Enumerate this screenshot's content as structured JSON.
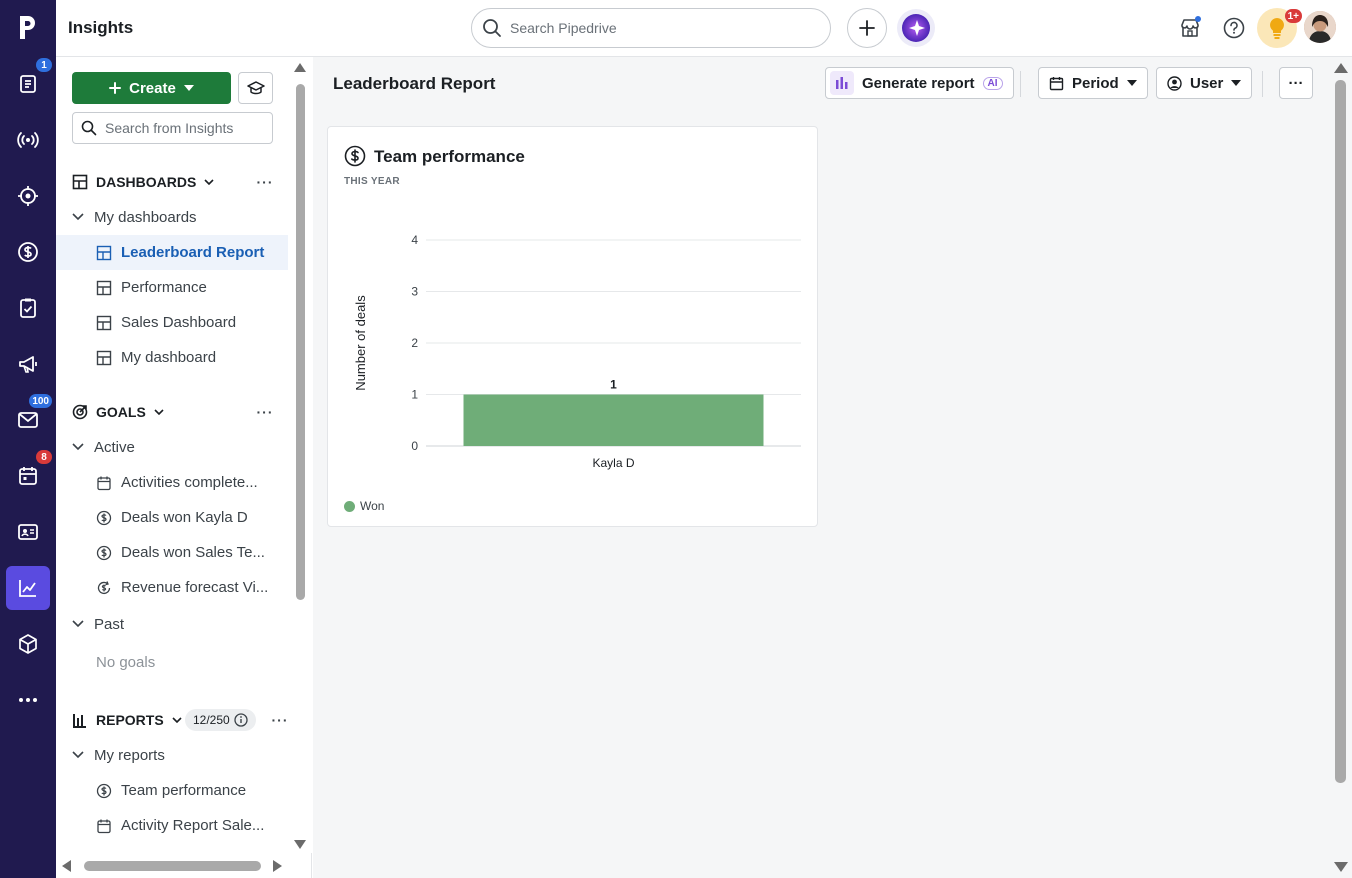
{
  "rail": {
    "logo": "p",
    "items": [
      {
        "icon": "leads-icon",
        "badge": "1",
        "badge_color": "#2f6fde"
      },
      {
        "icon": "broadcast-icon",
        "badge": ""
      },
      {
        "icon": "target-icon",
        "badge": ""
      },
      {
        "icon": "deals-dollar-icon",
        "badge": ""
      },
      {
        "icon": "tasks-clipboard-icon",
        "badge": ""
      },
      {
        "icon": "megaphone-icon",
        "badge": ""
      },
      {
        "icon": "mail-icon",
        "badge": "100",
        "badge_color": "#2f6fde"
      },
      {
        "icon": "calendar-icon",
        "badge": "8",
        "badge_color": "#d93a3a"
      },
      {
        "icon": "contacts-card-icon",
        "badge": ""
      },
      {
        "icon": "insights-chart-icon",
        "badge": "",
        "active": true
      },
      {
        "icon": "products-box-icon",
        "badge": ""
      },
      {
        "icon": "more-icon",
        "badge": ""
      }
    ]
  },
  "topbar": {
    "title": "Insights",
    "search_placeholder": "Search Pipedrive",
    "notification_badge": "1+"
  },
  "sidebar": {
    "create_label": "Create",
    "search_placeholder": "Search from Insights",
    "dashboards": {
      "header": "DASHBOARDS",
      "group": "My dashboards",
      "items": [
        "Leaderboard Report",
        "Performance",
        "Sales Dashboard",
        "My dashboard"
      ],
      "selected": "Leaderboard Report"
    },
    "goals": {
      "header": "GOALS",
      "active_label": "Active",
      "items": [
        "Activities complete...",
        "Deals won Kayla D",
        "Deals won Sales Te...",
        "Revenue forecast Vi..."
      ],
      "past_label": "Past",
      "empty_label": "No goals"
    },
    "reports": {
      "header": "REPORTS",
      "count": "12/250",
      "group": "My reports",
      "items": [
        "Team performance",
        "Activity Report Sale..."
      ]
    }
  },
  "main": {
    "title": "Leaderboard Report",
    "generate_label": "Generate report",
    "ai_label": "AI",
    "period_label": "Period",
    "user_label": "User",
    "more_label": "···"
  },
  "card": {
    "title": "Team performance",
    "subtitle": "THIS YEAR"
  },
  "chart_data": {
    "type": "bar",
    "categories": [
      "Kayla D"
    ],
    "series": [
      {
        "name": "Won",
        "values": [
          1
        ],
        "color": "#6fad78"
      }
    ],
    "data_labels": [
      "1"
    ],
    "ylabel": "Number of deals",
    "xlabel": "",
    "ylim": [
      0,
      4
    ],
    "yticks": [
      0,
      1,
      2,
      3,
      4
    ],
    "grid": true,
    "legend": "bottom-left"
  }
}
